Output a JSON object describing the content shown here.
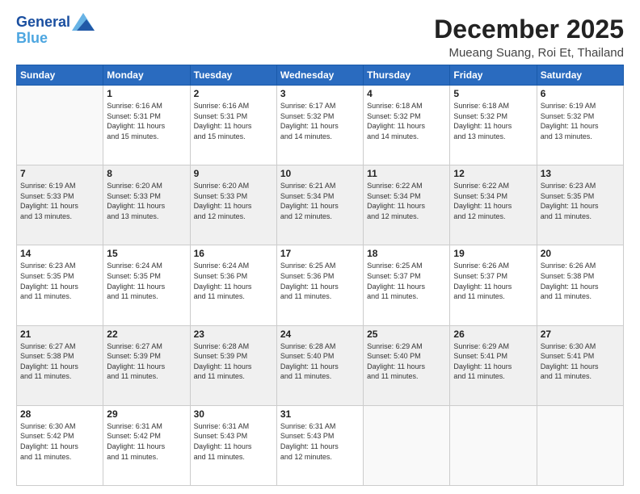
{
  "logo": {
    "line1": "General",
    "line2": "Blue"
  },
  "title": "December 2025",
  "subtitle": "Mueang Suang, Roi Et, Thailand",
  "headers": [
    "Sunday",
    "Monday",
    "Tuesday",
    "Wednesday",
    "Thursday",
    "Friday",
    "Saturday"
  ],
  "days": [
    {
      "num": "",
      "info": ""
    },
    {
      "num": "1",
      "info": "Sunrise: 6:16 AM\nSunset: 5:31 PM\nDaylight: 11 hours\nand 15 minutes."
    },
    {
      "num": "2",
      "info": "Sunrise: 6:16 AM\nSunset: 5:31 PM\nDaylight: 11 hours\nand 15 minutes."
    },
    {
      "num": "3",
      "info": "Sunrise: 6:17 AM\nSunset: 5:32 PM\nDaylight: 11 hours\nand 14 minutes."
    },
    {
      "num": "4",
      "info": "Sunrise: 6:18 AM\nSunset: 5:32 PM\nDaylight: 11 hours\nand 14 minutes."
    },
    {
      "num": "5",
      "info": "Sunrise: 6:18 AM\nSunset: 5:32 PM\nDaylight: 11 hours\nand 13 minutes."
    },
    {
      "num": "6",
      "info": "Sunrise: 6:19 AM\nSunset: 5:32 PM\nDaylight: 11 hours\nand 13 minutes."
    },
    {
      "num": "7",
      "info": "Sunrise: 6:19 AM\nSunset: 5:33 PM\nDaylight: 11 hours\nand 13 minutes."
    },
    {
      "num": "8",
      "info": "Sunrise: 6:20 AM\nSunset: 5:33 PM\nDaylight: 11 hours\nand 13 minutes."
    },
    {
      "num": "9",
      "info": "Sunrise: 6:20 AM\nSunset: 5:33 PM\nDaylight: 11 hours\nand 12 minutes."
    },
    {
      "num": "10",
      "info": "Sunrise: 6:21 AM\nSunset: 5:34 PM\nDaylight: 11 hours\nand 12 minutes."
    },
    {
      "num": "11",
      "info": "Sunrise: 6:22 AM\nSunset: 5:34 PM\nDaylight: 11 hours\nand 12 minutes."
    },
    {
      "num": "12",
      "info": "Sunrise: 6:22 AM\nSunset: 5:34 PM\nDaylight: 11 hours\nand 12 minutes."
    },
    {
      "num": "13",
      "info": "Sunrise: 6:23 AM\nSunset: 5:35 PM\nDaylight: 11 hours\nand 11 minutes."
    },
    {
      "num": "14",
      "info": "Sunrise: 6:23 AM\nSunset: 5:35 PM\nDaylight: 11 hours\nand 11 minutes."
    },
    {
      "num": "15",
      "info": "Sunrise: 6:24 AM\nSunset: 5:35 PM\nDaylight: 11 hours\nand 11 minutes."
    },
    {
      "num": "16",
      "info": "Sunrise: 6:24 AM\nSunset: 5:36 PM\nDaylight: 11 hours\nand 11 minutes."
    },
    {
      "num": "17",
      "info": "Sunrise: 6:25 AM\nSunset: 5:36 PM\nDaylight: 11 hours\nand 11 minutes."
    },
    {
      "num": "18",
      "info": "Sunrise: 6:25 AM\nSunset: 5:37 PM\nDaylight: 11 hours\nand 11 minutes."
    },
    {
      "num": "19",
      "info": "Sunrise: 6:26 AM\nSunset: 5:37 PM\nDaylight: 11 hours\nand 11 minutes."
    },
    {
      "num": "20",
      "info": "Sunrise: 6:26 AM\nSunset: 5:38 PM\nDaylight: 11 hours\nand 11 minutes."
    },
    {
      "num": "21",
      "info": "Sunrise: 6:27 AM\nSunset: 5:38 PM\nDaylight: 11 hours\nand 11 minutes."
    },
    {
      "num": "22",
      "info": "Sunrise: 6:27 AM\nSunset: 5:39 PM\nDaylight: 11 hours\nand 11 minutes."
    },
    {
      "num": "23",
      "info": "Sunrise: 6:28 AM\nSunset: 5:39 PM\nDaylight: 11 hours\nand 11 minutes."
    },
    {
      "num": "24",
      "info": "Sunrise: 6:28 AM\nSunset: 5:40 PM\nDaylight: 11 hours\nand 11 minutes."
    },
    {
      "num": "25",
      "info": "Sunrise: 6:29 AM\nSunset: 5:40 PM\nDaylight: 11 hours\nand 11 minutes."
    },
    {
      "num": "26",
      "info": "Sunrise: 6:29 AM\nSunset: 5:41 PM\nDaylight: 11 hours\nand 11 minutes."
    },
    {
      "num": "27",
      "info": "Sunrise: 6:30 AM\nSunset: 5:41 PM\nDaylight: 11 hours\nand 11 minutes."
    },
    {
      "num": "28",
      "info": "Sunrise: 6:30 AM\nSunset: 5:42 PM\nDaylight: 11 hours\nand 11 minutes."
    },
    {
      "num": "29",
      "info": "Sunrise: 6:31 AM\nSunset: 5:42 PM\nDaylight: 11 hours\nand 11 minutes."
    },
    {
      "num": "30",
      "info": "Sunrise: 6:31 AM\nSunset: 5:43 PM\nDaylight: 11 hours\nand 11 minutes."
    },
    {
      "num": "31",
      "info": "Sunrise: 6:31 AM\nSunset: 5:43 PM\nDaylight: 11 hours\nand 12 minutes."
    },
    {
      "num": "",
      "info": ""
    },
    {
      "num": "",
      "info": ""
    },
    {
      "num": "",
      "info": ""
    }
  ]
}
